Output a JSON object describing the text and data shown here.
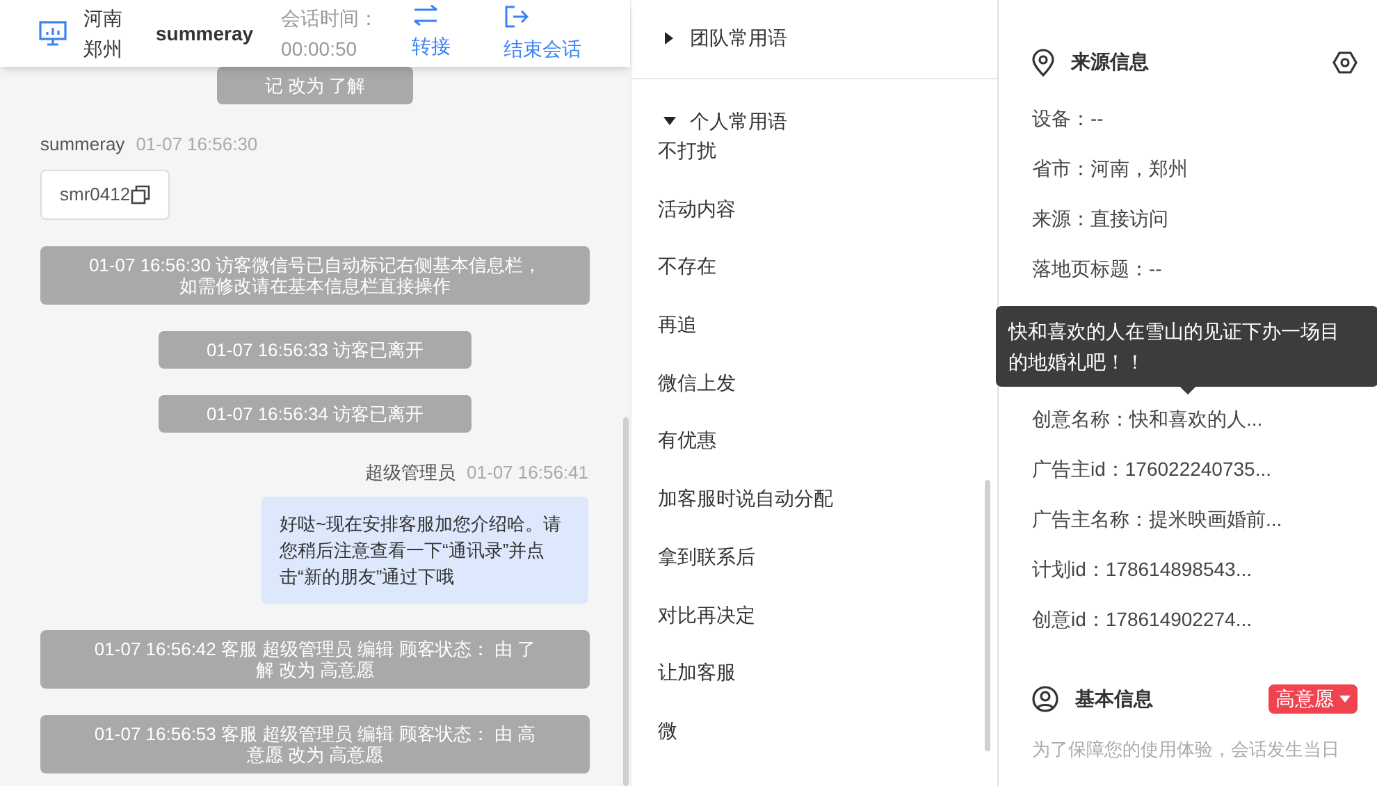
{
  "header": {
    "location_lines": [
      "河南",
      "郑州"
    ],
    "visitor_name": "summeray",
    "session_label": "会话时间：",
    "session_time": "00:00:50",
    "actions": [
      {
        "kind": "transfer",
        "label": "转接"
      },
      {
        "kind": "end",
        "label": "结束会话"
      }
    ]
  },
  "messages": [
    {
      "kind": "system",
      "text": "记 改为 了解"
    },
    {
      "kind": "visitor_card",
      "name": "summeray",
      "time": "01-07 16:56:30",
      "text": "smr0412"
    },
    {
      "kind": "system",
      "text": "01-07 16:56:30 访客微信号已自动标记右侧基本信息栏，如需修改请在基本信息栏直接操作"
    },
    {
      "kind": "system",
      "text": "01-07 16:56:33 访客已离开"
    },
    {
      "kind": "system",
      "text": "01-07 16:56:34 访客已离开"
    },
    {
      "kind": "agent",
      "name": "超级管理员",
      "time": "01-07 16:56:41",
      "text": "好哒~现在安排客服加您介绍哈。请您稍后注意查看一下“通讯录”并点击“新的朋友”通过下哦"
    },
    {
      "kind": "system",
      "text": "01-07 16:56:42 客服 超级管理员 编辑 顾客状态： 由 了解 改为 高意愿"
    },
    {
      "kind": "system",
      "text": "01-07 16:56:53 客服 超级管理员 编辑 顾客状态： 由 高意愿 改为 高意愿"
    }
  ],
  "phrases": {
    "groups": [
      {
        "title": "团队常用语",
        "expanded": false
      },
      {
        "title": "个人常用语",
        "expanded": true,
        "items": [
          "不打扰",
          "活动内容",
          "不存在",
          "再追",
          "微信上发",
          "有优惠",
          "加客服时说自动分配",
          "拿到联系后",
          "对比再决定",
          "让加客服",
          "微"
        ]
      }
    ]
  },
  "source_info": {
    "title": "来源信息",
    "rows_before": [
      "设备：--",
      "省市：河南，郑州",
      "来源：直接访问",
      "落地页标题：--"
    ],
    "tooltip": "快和喜欢的人在雪山的见证下办一场目的地婚礼吧！！",
    "rows_after": [
      "创意名称：快和喜欢的人...",
      "广告主id：176022240735...",
      "广告主名称：提米映画婚前...",
      "计划id：178614898543...",
      "创意id：178614902274..."
    ]
  },
  "basic_info": {
    "title": "基本信息",
    "status_badge": "高意愿",
    "note": "为了保障您的使用体验，会话发生当日"
  }
}
